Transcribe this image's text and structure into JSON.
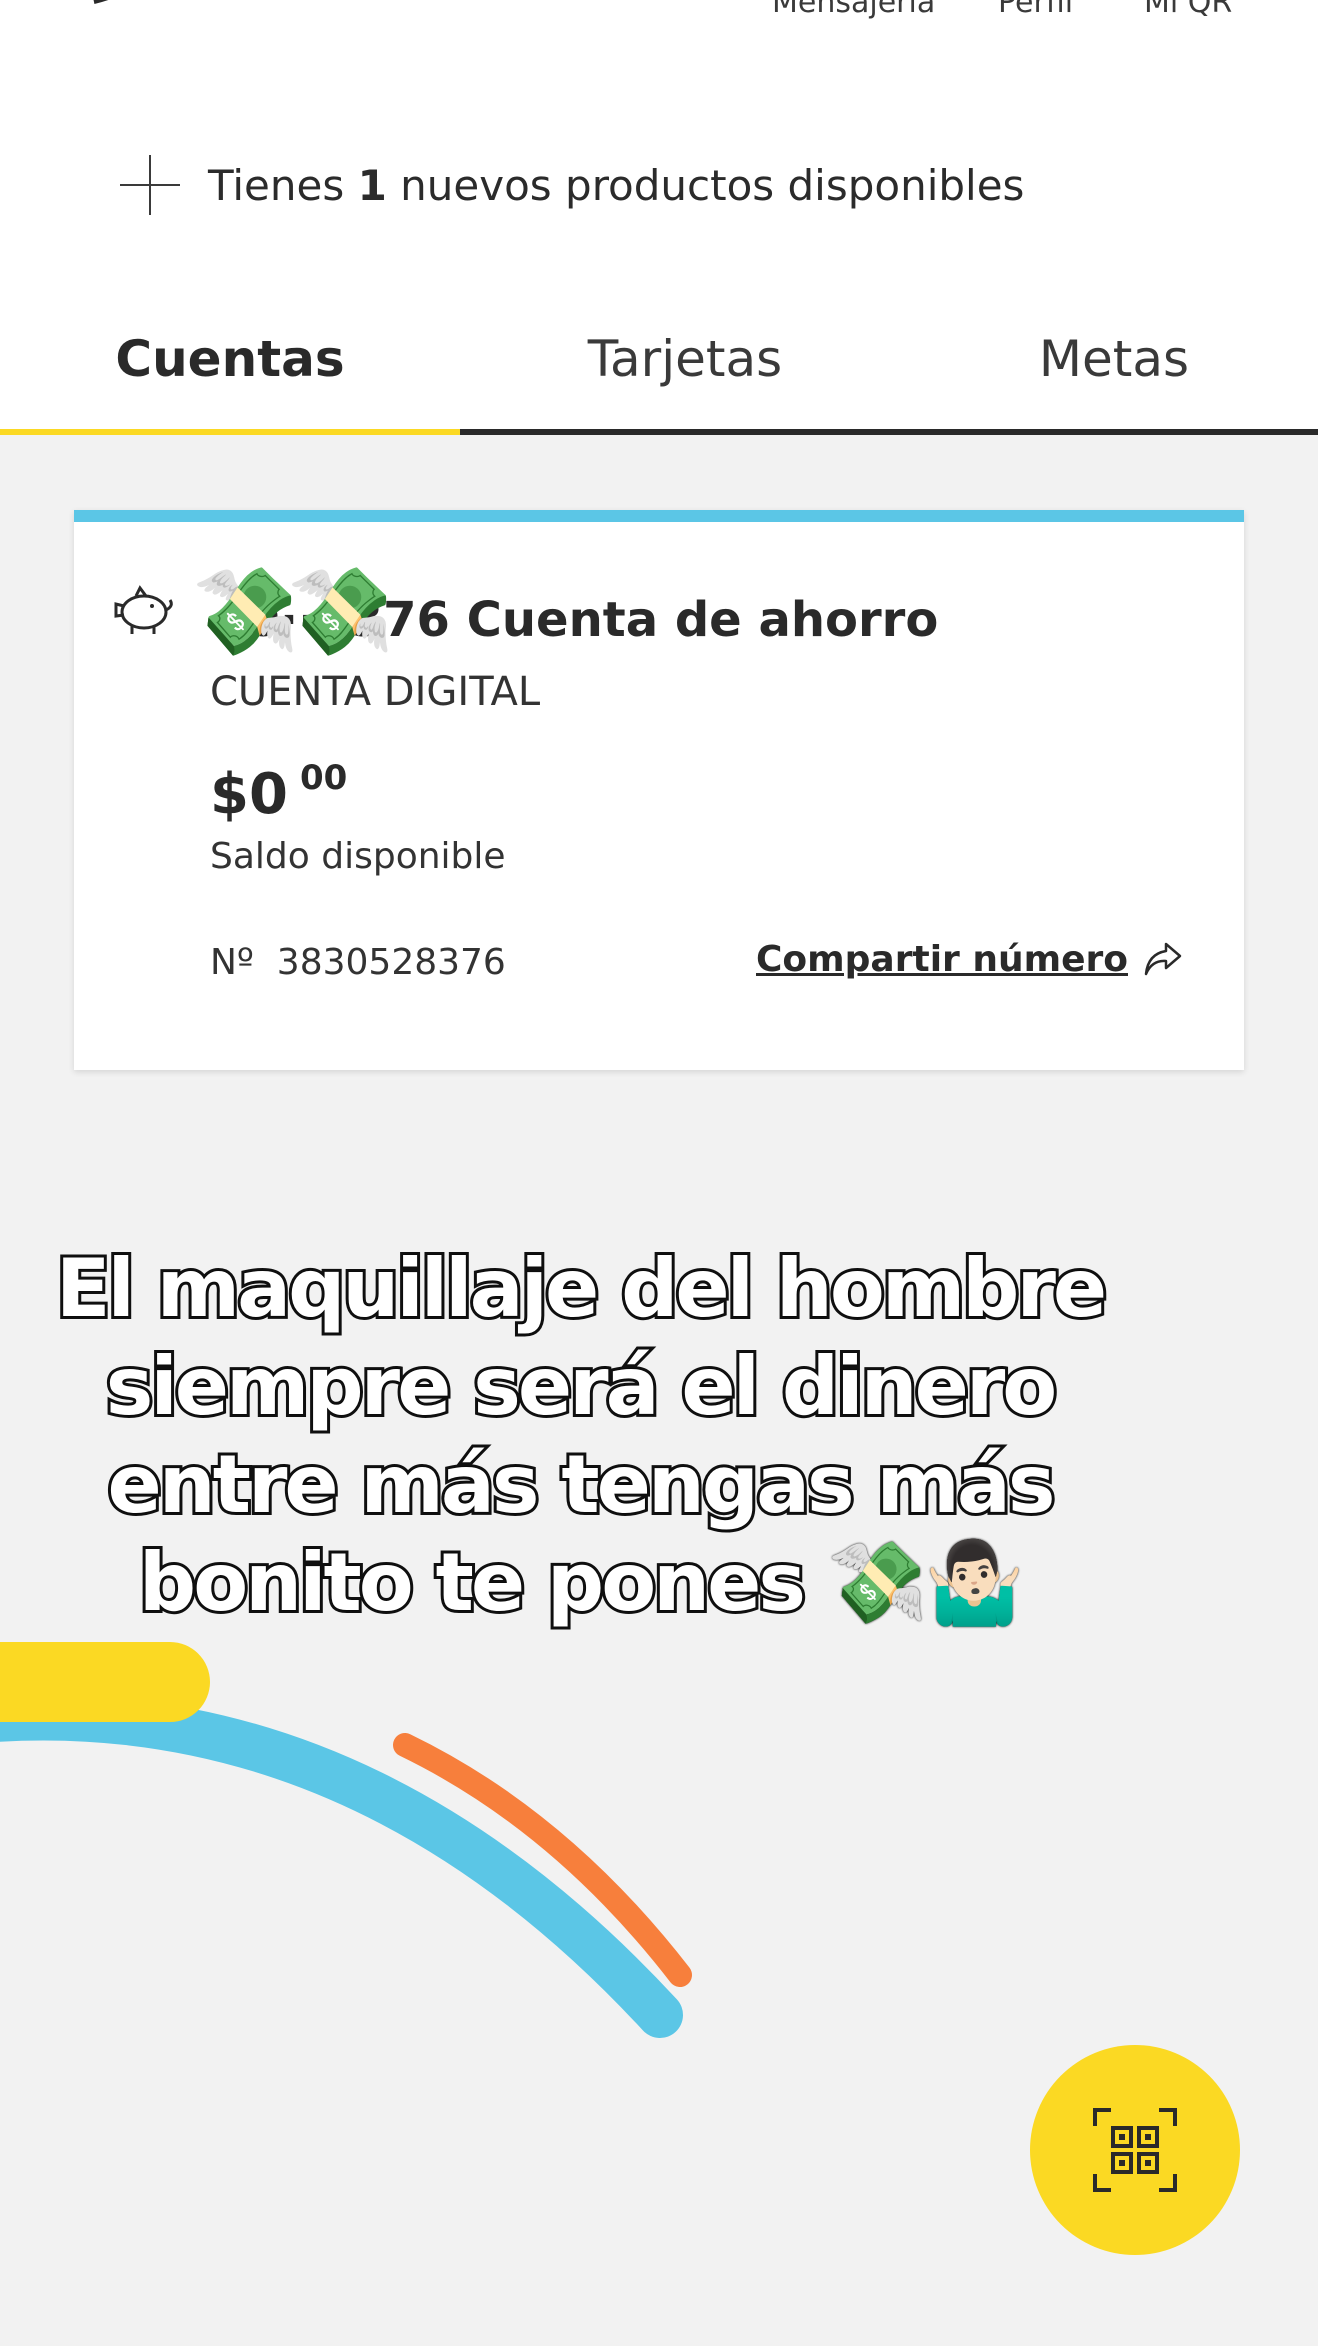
{
  "top_nav": {
    "items": [
      "Mensajería",
      "Perfil",
      "Mi QR"
    ]
  },
  "new_products": {
    "prefix": "Tienes",
    "count": "1",
    "suffix": "nuevos productos disponibles"
  },
  "tabs": [
    {
      "label": "Cuentas",
      "active": true
    },
    {
      "label": "Tarjetas",
      "active": false
    },
    {
      "label": "Metas",
      "active": false
    }
  ],
  "account": {
    "title": "··0··8376 Cuenta de ahorro",
    "subtitle": "CUENTA DIGITAL",
    "balance_whole": "$0",
    "balance_cents": "00",
    "balance_label": "Saldo disponible",
    "number_label": "Nº",
    "number": "3830528376",
    "share_label": "Compartir número",
    "emoji_overlay": "💸💸"
  },
  "caption": "El maquillaje del hombre siempre será el dinero entre más tengas más bonito te pones 💸🤷🏻‍♂️",
  "colors": {
    "accent_yellow": "#fbd923",
    "accent_blue": "#5bc6e6",
    "accent_orange": "#f77f3c",
    "background": "#f2f2f2"
  },
  "icons": {
    "new_products": "plus-icon",
    "account": "piggy-bank-icon",
    "share": "share-arrow-icon",
    "fab": "qr-scan-icon"
  }
}
